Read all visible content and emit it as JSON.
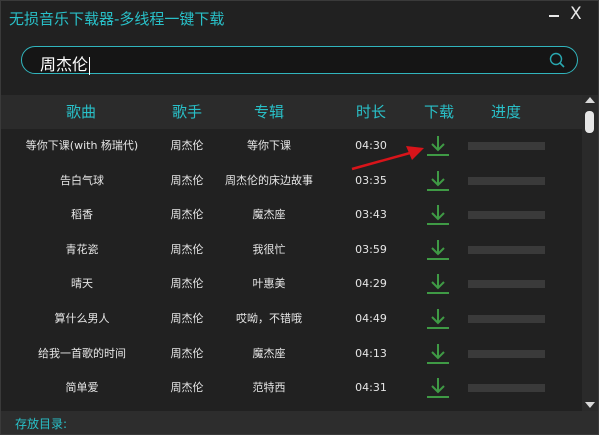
{
  "app": {
    "title": "无损音乐下载器-多线程一键下载",
    "close_label": "X"
  },
  "search": {
    "value": "周杰伦",
    "icon": "search-icon"
  },
  "table": {
    "headers": [
      "歌曲",
      "歌手",
      "专辑",
      "时长",
      "下载",
      "进度"
    ],
    "rows": [
      {
        "song": "等你下课(with 杨瑞代)",
        "artist": "周杰伦",
        "album": "等你下课",
        "duration": "04:30"
      },
      {
        "song": "告白气球",
        "artist": "周杰伦",
        "album": "周杰伦的床边故事",
        "duration": "03:35"
      },
      {
        "song": "稻香",
        "artist": "周杰伦",
        "album": "魔杰座",
        "duration": "03:43"
      },
      {
        "song": "青花瓷",
        "artist": "周杰伦",
        "album": "我很忙",
        "duration": "03:59"
      },
      {
        "song": "晴天",
        "artist": "周杰伦",
        "album": "叶惠美",
        "duration": "04:29"
      },
      {
        "song": "算什么男人",
        "artist": "周杰伦",
        "album": "哎呦，不错哦",
        "duration": "04:49"
      },
      {
        "song": "给我一首歌的时间",
        "artist": "周杰伦",
        "album": "魔杰座",
        "duration": "04:13"
      },
      {
        "song": "简单爱",
        "artist": "周杰伦",
        "album": "范特西",
        "duration": "04:31"
      }
    ],
    "progress": [
      0,
      0,
      0,
      0,
      0,
      0,
      0,
      0
    ],
    "download_icon": "download-icon"
  },
  "footer": {
    "label": "存放目录:"
  },
  "colors": {
    "accent": "#29c0c8",
    "download_green": "#3f9a45",
    "annotation_arrow": "#d8141a"
  }
}
